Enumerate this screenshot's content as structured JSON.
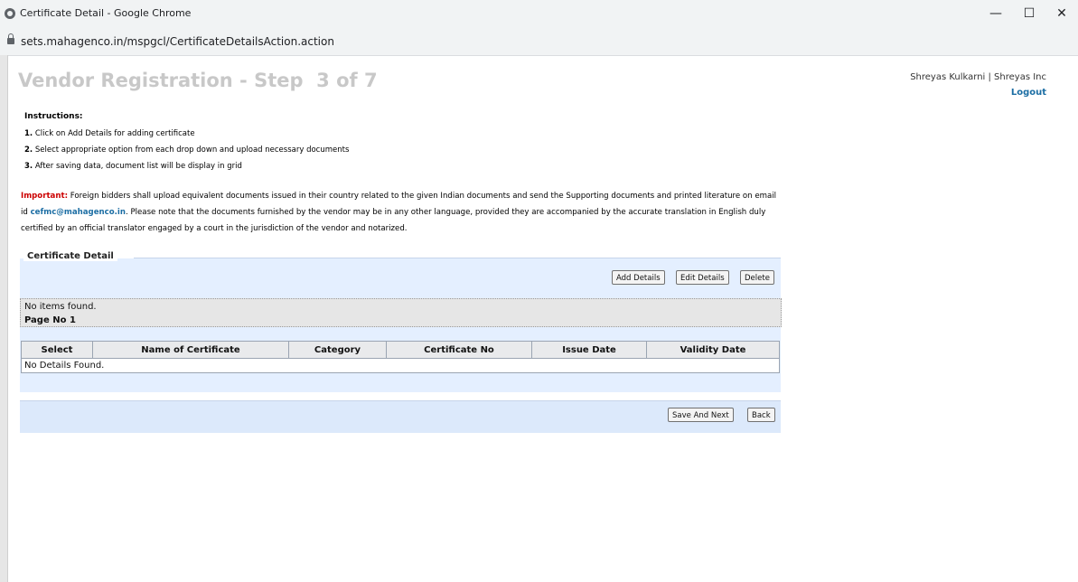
{
  "window": {
    "title": "Certificate Detail - Google Chrome",
    "url": "sets.mahagenco.in/mspgcl/CertificateDetailsAction.action",
    "minimize": "—",
    "maximize": "☐",
    "close": "✕"
  },
  "header": {
    "title": "Vendor Registration - Step  3 of 7",
    "user": "Shreyas Kulkarni | Shreyas Inc",
    "logout": "Logout"
  },
  "instructions": {
    "heading": "Instructions:",
    "items": [
      {
        "num": "1.",
        "text": " Click on Add Details for adding certificate"
      },
      {
        "num": "2.",
        "text": " Select appropriate option from each drop down and upload necessary documents"
      },
      {
        "num": "3.",
        "text": " After saving data, document list will be display in grid"
      }
    ]
  },
  "important": {
    "label": "Important:",
    "text1": " Foreign bidders shall upload equivalent documents issued in their country related to the given Indian documents and send the Supporting documents and printed literature on email id ",
    "email": "cefmc@mahagenco.in",
    "text2": ". Please note that the documents furnished by the vendor may be in any other language, provided they are accompanied by the accurate translation in English duly certified by an official translator engaged by a court in the jurisdiction of the vendor and notarized."
  },
  "certificate": {
    "legend": "Certificate Detail",
    "add_button": "Add Details",
    "edit_button": "Edit Details",
    "delete_button": "Delete",
    "no_items": "No items found.",
    "page_no": "Page No 1",
    "columns": [
      "Select",
      "Name of Certificate",
      "Category",
      "Certificate No",
      "Issue Date",
      "Validity Date"
    ],
    "no_details": "No Details Found."
  },
  "footer": {
    "save_next": "Save And Next",
    "back": "Back"
  }
}
